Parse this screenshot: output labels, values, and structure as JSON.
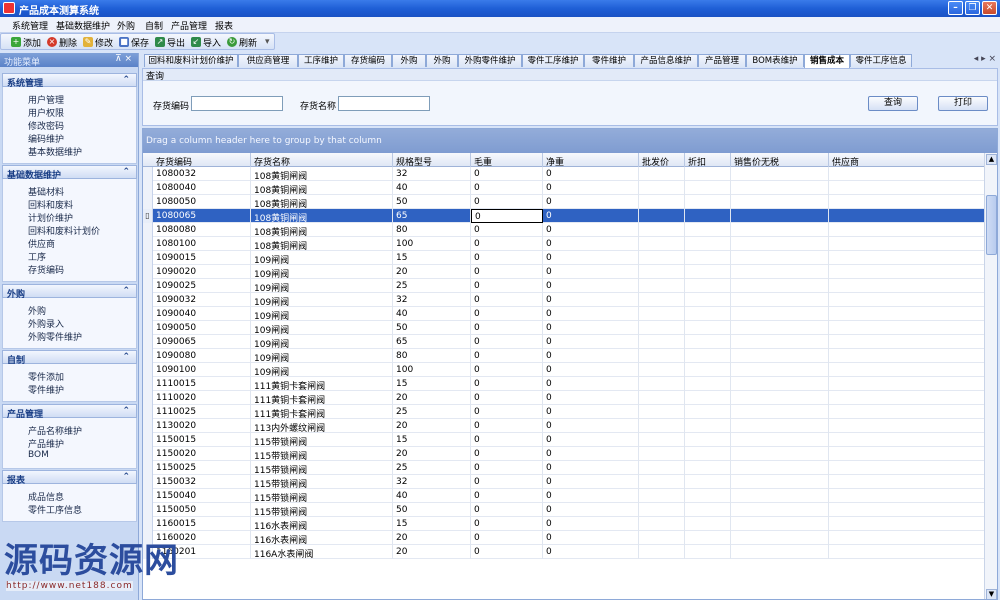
{
  "window": {
    "title": "产品成本测算系统"
  },
  "menubar": [
    "系统管理",
    "基础数据维护",
    "外购",
    "自制",
    "产品管理",
    "报表"
  ],
  "toolbar": {
    "add": "添加",
    "delete": "删除",
    "edit": "修改",
    "save": "保存",
    "export": "导出",
    "import": "导入",
    "refresh": "刷新"
  },
  "sidebar": {
    "title": "功能菜单",
    "groups": [
      {
        "title": "系统管理",
        "items": [
          "用户管理",
          "用户权限",
          "修改密码",
          "编码维护",
          "基本数据维护"
        ]
      },
      {
        "title": "基础数据维护",
        "items": [
          "基础材料",
          "回料和废料",
          "计划价维护",
          "回料和废料计划价",
          "供应商",
          "工序",
          "存货编码"
        ]
      },
      {
        "title": "外购",
        "items": [
          "外购",
          "外购录入",
          "外购零件维护"
        ]
      },
      {
        "title": "自制",
        "items": [
          "零件添加",
          "零件维护"
        ]
      },
      {
        "title": "产品管理",
        "items": [
          "产品名称维护",
          "产品维护",
          "BOM"
        ]
      },
      {
        "title": "报表",
        "items": [
          "成品信息",
          "零件工序信息"
        ]
      }
    ]
  },
  "tabs": [
    "回料和废料计划价维护",
    "供应商管理",
    "工序维护",
    "存货编码",
    "外购",
    "外购",
    "外购零件维护",
    "零件工序维护",
    "零件维护",
    "产品信息维护",
    "产品管理",
    "BOM表维护",
    "销售成本",
    "零件工序信息"
  ],
  "active_tab": "销售成本",
  "query": {
    "title": "查询",
    "code_label": "存货编码",
    "name_label": "存货名称",
    "code_value": "",
    "name_value": "",
    "search_button": "查询",
    "print_button": "打印"
  },
  "grid": {
    "group_hint": "Drag a column header here to group by that column",
    "columns": [
      "存货编码",
      "存货名称",
      "规格型号",
      "毛重",
      "净重",
      "批发价",
      "折扣",
      "销售价无税",
      "供应商"
    ],
    "rows": [
      [
        "1080032",
        "108黄铜闸阀",
        "32",
        "0",
        "0"
      ],
      [
        "1080040",
        "108黄铜闸阀",
        "40",
        "0",
        "0"
      ],
      [
        "1080050",
        "108黄铜闸阀",
        "50",
        "0",
        "0"
      ],
      [
        "1080065",
        "108黄铜闸阀",
        "65",
        "0",
        "0"
      ],
      [
        "1080080",
        "108黄铜闸阀",
        "80",
        "0",
        "0"
      ],
      [
        "1080100",
        "108黄铜闸阀",
        "100",
        "0",
        "0"
      ],
      [
        "1090015",
        "109闸阀",
        "15",
        "0",
        "0"
      ],
      [
        "1090020",
        "109闸阀",
        "20",
        "0",
        "0"
      ],
      [
        "1090025",
        "109闸阀",
        "25",
        "0",
        "0"
      ],
      [
        "1090032",
        "109闸阀",
        "32",
        "0",
        "0"
      ],
      [
        "1090040",
        "109闸阀",
        "40",
        "0",
        "0"
      ],
      [
        "1090050",
        "109闸阀",
        "50",
        "0",
        "0"
      ],
      [
        "1090065",
        "109闸阀",
        "65",
        "0",
        "0"
      ],
      [
        "1090080",
        "109闸阀",
        "80",
        "0",
        "0"
      ],
      [
        "1090100",
        "109闸阀",
        "100",
        "0",
        "0"
      ],
      [
        "1110015",
        "111黄铜卡套闸阀",
        "15",
        "0",
        "0"
      ],
      [
        "1110020",
        "111黄铜卡套闸阀",
        "20",
        "0",
        "0"
      ],
      [
        "1110025",
        "111黄铜卡套闸阀",
        "25",
        "0",
        "0"
      ],
      [
        "1130020",
        "113内外螺纹闸阀",
        "20",
        "0",
        "0"
      ],
      [
        "1150015",
        "115带锁闸阀",
        "15",
        "0",
        "0"
      ],
      [
        "1150020",
        "115带锁闸阀",
        "20",
        "0",
        "0"
      ],
      [
        "1150025",
        "115带锁闸阀",
        "25",
        "0",
        "0"
      ],
      [
        "1150032",
        "115带锁闸阀",
        "32",
        "0",
        "0"
      ],
      [
        "1150040",
        "115带锁闸阀",
        "40",
        "0",
        "0"
      ],
      [
        "1150050",
        "115带锁闸阀",
        "50",
        "0",
        "0"
      ],
      [
        "1160015",
        "116水表闸阀",
        "15",
        "0",
        "0"
      ],
      [
        "1160020",
        "116水表闸阀",
        "20",
        "0",
        "0"
      ],
      [
        "1160201",
        "116A水表闸阀",
        "20",
        "0",
        "0"
      ]
    ],
    "selected_row": 3,
    "row_indicator": "▯"
  },
  "watermark": {
    "text": "源码资源网",
    "url": "http://www.net188.com"
  }
}
